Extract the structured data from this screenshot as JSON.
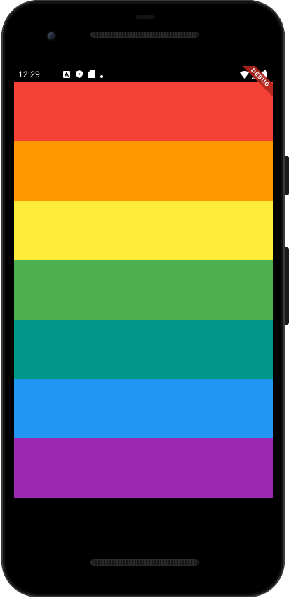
{
  "status_bar": {
    "time": "12:29",
    "left_icons": [
      "font-a-icon",
      "play-protect-icon",
      "sd-card-icon",
      "dot-icon"
    ],
    "right_icons": [
      "wifi-icon",
      "signal-icon",
      "battery-icon"
    ]
  },
  "debug_banner": {
    "label": "DEBUG",
    "color": "#b3261e"
  },
  "stripes": [
    {
      "name": "red",
      "color": "#F44336"
    },
    {
      "name": "orange",
      "color": "#FF9800"
    },
    {
      "name": "yellow",
      "color": "#FFEB3B"
    },
    {
      "name": "green",
      "color": "#4CAF50"
    },
    {
      "name": "teal",
      "color": "#009688"
    },
    {
      "name": "blue",
      "color": "#2196F3"
    },
    {
      "name": "purple",
      "color": "#9C27B0"
    }
  ]
}
